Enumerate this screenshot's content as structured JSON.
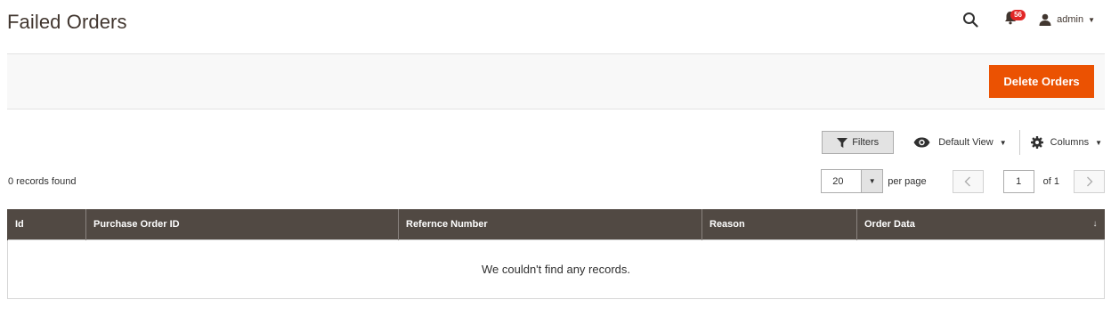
{
  "page": {
    "title": "Failed Orders"
  },
  "header": {
    "notification_count": "56",
    "user_name": "admin"
  },
  "actions": {
    "delete_label": "Delete Orders"
  },
  "toolbar": {
    "filters_label": "Filters",
    "view_label": "Default View",
    "columns_label": "Columns"
  },
  "grid": {
    "records_found": "0 records found",
    "per_page_value": "20",
    "per_page_label": "per page",
    "current_page": "1",
    "of_pages": "of 1",
    "columns": [
      "Id",
      "Purchase Order ID",
      "Refernce Number",
      "Reason",
      "Order Data"
    ],
    "empty_message": "We couldn't find any records."
  },
  "colors": {
    "accent": "#eb5202",
    "header_bg": "#514943",
    "badge": "#e22626"
  }
}
